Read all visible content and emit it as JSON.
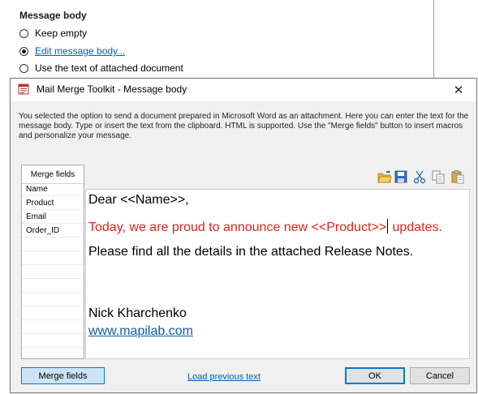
{
  "background": {
    "section_title": "Message body",
    "options": [
      {
        "label": "Keep empty",
        "checked": false
      },
      {
        "label": "Edit message body...",
        "checked": true
      },
      {
        "label": "Use the text of attached document",
        "checked": false
      }
    ]
  },
  "dialog": {
    "title": "Mail Merge Toolkit - Message body",
    "close_glyph": "✕",
    "description": "You selected the option to send a document prepared in Microsoft Word as an attachment. Here you can enter the text for the message body. Type or insert the text from the clipboard. HTML is supported. Use the \"Merge fields\" button to insert macros and personalize your message.",
    "merge_fields": {
      "header": "Merge fields",
      "items": [
        "Name",
        "Product",
        "Email",
        "Order_ID"
      ]
    },
    "toolbar": [
      "open-folder-icon",
      "save-icon",
      "cut-icon",
      "copy-icon",
      "paste-icon"
    ],
    "editor": {
      "line1": "Dear <<Name>>,",
      "line2_before_caret": "Today, we are proud to announce new <<Product>>",
      "line2_after_caret": " updates.",
      "line3": "Please find all the details in the attached Release Notes.",
      "signature_name": "Nick Kharchenko",
      "signature_link": "www.mapilab.com"
    },
    "buttons": {
      "merge_fields": "Merge fields",
      "load_previous": "Load previous text",
      "ok": "OK",
      "cancel": "Cancel"
    },
    "colors": {
      "accent": "#0078d7",
      "highlight_text": "#e2231a",
      "link": "#0b5cad"
    }
  }
}
